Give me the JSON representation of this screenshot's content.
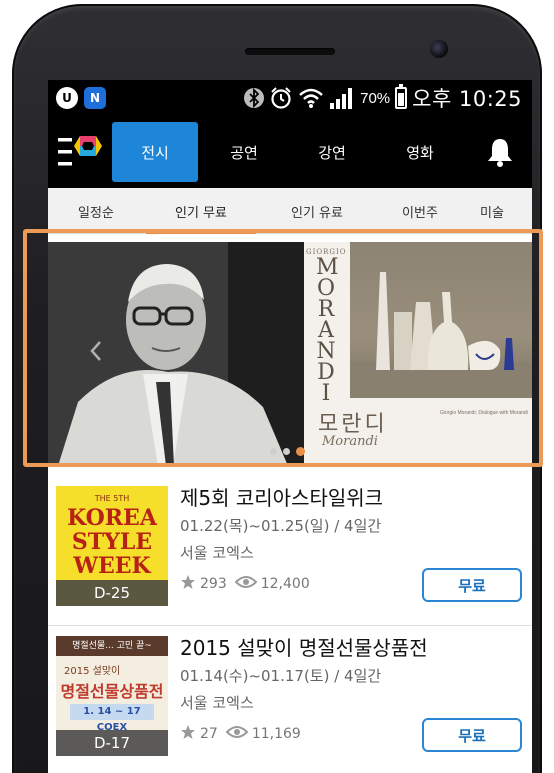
{
  "status_bar": {
    "battery": "70%",
    "time": "오후 10:25",
    "badge_u": "U",
    "badge_n": "N",
    "icons": [
      "u-plus-icon",
      "naver-icon",
      "bluetooth-icon",
      "alarm-icon",
      "wifi-icon",
      "signal-icon",
      "battery-icon"
    ]
  },
  "app_bar": {
    "tabs": [
      {
        "label": "전시",
        "active": true
      },
      {
        "label": "공연",
        "active": false
      },
      {
        "label": "강연",
        "active": false
      },
      {
        "label": "영화",
        "active": false
      }
    ],
    "icons": [
      "logo-icon",
      "bell-icon"
    ]
  },
  "filters": [
    {
      "label": "일정순"
    },
    {
      "label": "인기 무료",
      "active": true
    },
    {
      "label": "인기 유료"
    },
    {
      "label": "이번주"
    },
    {
      "label": "미술"
    }
  ],
  "banner": {
    "poster_small": "GIORGIO",
    "poster_vertical": "MORANDI",
    "poster_korean": "모란디",
    "poster_signature": "Morandi",
    "poster_info": "Giorgio Morandi: Dialogue with Morandi",
    "slides_total": 3,
    "active_slide": 3,
    "accent": "#ed9a57"
  },
  "events": [
    {
      "title": "제5회 코리아스타일위크",
      "date": "01.22(목)~01.25(일) / 4일간",
      "venue": "서울 코엑스",
      "likes": "293",
      "views": "12,400",
      "price": "무료",
      "dday": "D-25",
      "thumb_sub": "THE 5TH",
      "thumb_lines": [
        "KOREA",
        "STYLE",
        "WEEK"
      ]
    },
    {
      "title": "2015 설맞이 명절선물상품전",
      "date": "01.14(수)~01.17(토) / 4일간",
      "venue": "서울 코엑스",
      "likes": "27",
      "views": "11,169",
      "price": "무료",
      "dday": "D-17",
      "thumb_top": "명절선물... 고민 끝~",
      "thumb_year": "2015 설맞이",
      "thumb_title": "명절선물상품전",
      "thumb_date": "1. 14 ~ 17 COEX"
    }
  ],
  "colors": {
    "tab_active": "#1e86d8",
    "price_border": "#2d86d3",
    "highlight": "#ed9a57"
  }
}
